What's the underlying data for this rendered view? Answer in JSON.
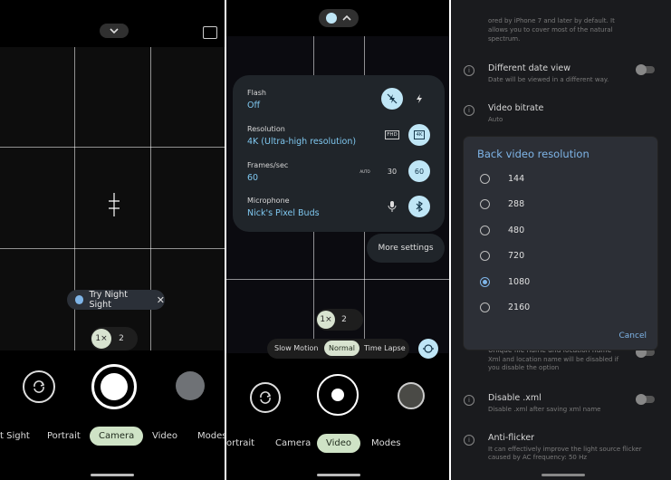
{
  "panel1": {
    "night_sight_chip": "Try Night Sight",
    "zoom": [
      "1×",
      "2"
    ],
    "modes": [
      "t Sight",
      "Portrait",
      "Camera",
      "Video",
      "Modes"
    ],
    "selected_mode": "Camera"
  },
  "panel2": {
    "settings": {
      "flash": {
        "label": "Flash",
        "value": "Off"
      },
      "resolution": {
        "label": "Resolution",
        "value": "4K (Ultra-high resolution)",
        "opt1": "FHD",
        "opt2": "4K"
      },
      "frames": {
        "label": "Frames/sec",
        "value": "60",
        "opt1": "AUTO",
        "opt2": "30",
        "opt3": "60"
      },
      "microphone": {
        "label": "Microphone",
        "value": "Nick's Pixel Buds"
      }
    },
    "more_settings": "More settings",
    "zoom": [
      "1×",
      "2"
    ],
    "video_modes": [
      "Slow Motion",
      "Normal",
      "Time Lapse"
    ],
    "modes": [
      "ortrait",
      "Camera",
      "Video",
      "Modes"
    ],
    "selected_mode": "Video"
  },
  "panel3": {
    "top_text": [
      "ored by iPhone 7 and later by default.  It",
      "allows you to cover most of the natural",
      "spectrum."
    ],
    "date_view": {
      "title": "Different date view",
      "sub": "Date will be viewed in a different way."
    },
    "bitrate": {
      "title": "Video bitrate",
      "sub": "Auto"
    },
    "dialog": {
      "title": "Back video resolution",
      "options": [
        "144",
        "288",
        "480",
        "720",
        "1080",
        "2160"
      ],
      "selected": "1080",
      "cancel": "Cancel"
    },
    "hidden_row": {
      "title": "Unique file name and location name",
      "sub1": "Xml and location name will be disabled if",
      "sub2": "you disable the option"
    },
    "disable_xml": {
      "title": "Disable .xml",
      "sub": "Disable .xml after saving xml name"
    },
    "anti_flicker": {
      "title": "Anti-flicker",
      "sub1": "It can effectively improve the light source flicker",
      "sub2": "caused by AC frequency: 50 Hz"
    }
  }
}
